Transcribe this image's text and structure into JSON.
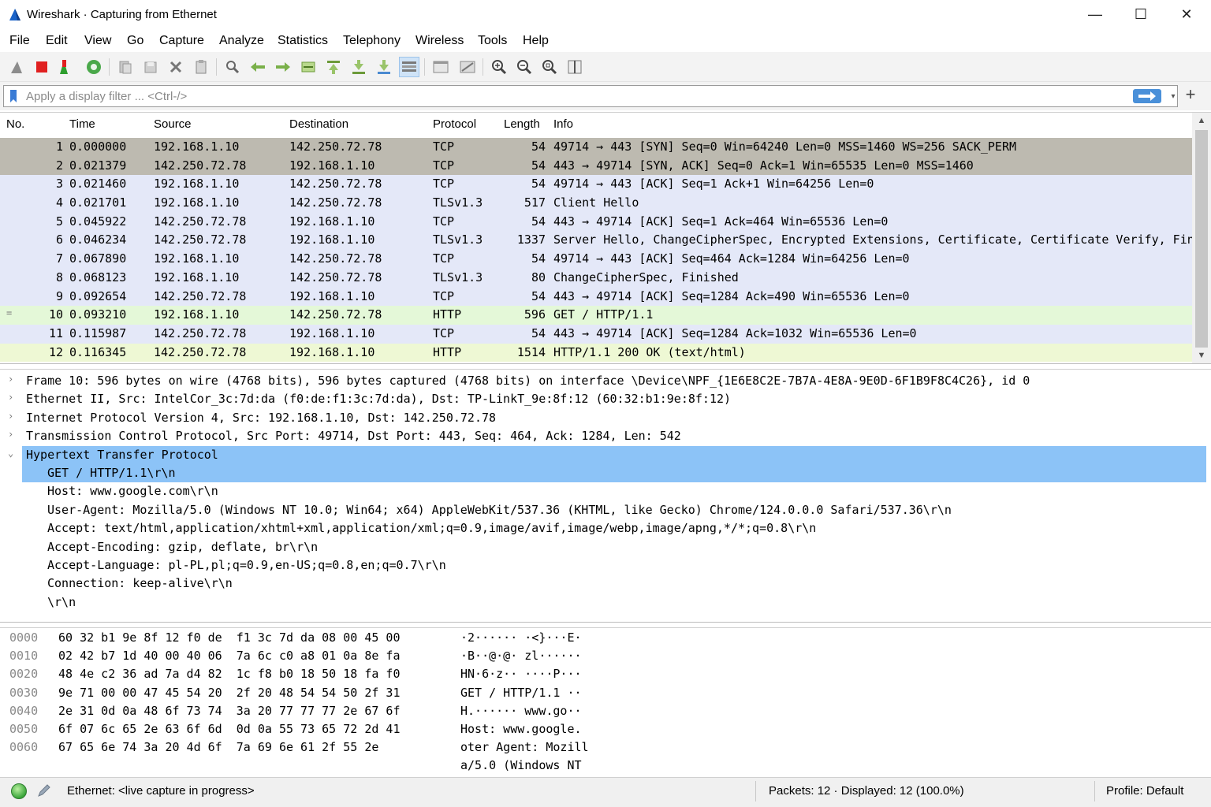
{
  "window": {
    "title": "Wireshark · Capturing from Ethernet",
    "controls": {
      "minimize": "—",
      "maximize": "☐",
      "close": "✕"
    }
  },
  "menu": [
    "File",
    "Edit",
    "View",
    "Go",
    "Capture",
    "Analyze",
    "Statistics",
    "Telephony",
    "Wireless",
    "Tools",
    "Help"
  ],
  "toolbar": {
    "icons": [
      "shark-fin-start-icon",
      "stop-square-icon",
      "restart-icon",
      "capture-options-icon",
      "open-file-icon",
      "save-file-icon",
      "close-file-icon",
      "reload-file-icon",
      "find-packet-icon",
      "go-back-icon",
      "go-forward-icon",
      "go-to-packet-icon",
      "go-first-icon",
      "go-last-icon",
      "autoscroll-icon",
      "colorize-icon",
      "auto-resize-icon",
      "zoom-in-icon",
      "zoom-out-icon",
      "normal-size-icon",
      "resize-columns-icon"
    ]
  },
  "filter": {
    "placeholder": "Apply a display filter ... <Ctrl-/>",
    "apply_icon": "arrow-right-icon",
    "dropdown": "▾",
    "add": "+"
  },
  "packet_list": {
    "columns": [
      "No.",
      "Time",
      "Source",
      "Destination",
      "Protocol",
      "Length",
      "Info"
    ],
    "rows": [
      {
        "no": "1",
        "time": "0.000000",
        "src": "192.168.1.10",
        "dst": "142.250.72.78",
        "proto": "TCP",
        "len": "54",
        "info": "49714 → 443 [SYN] Seq=0 Win=64240 Len=0 MSS=1460 WS=256 SACK_PERM",
        "bg": "#bdbab0",
        "mark": ""
      },
      {
        "no": "2",
        "time": "0.021379",
        "src": "142.250.72.78",
        "dst": "192.168.1.10",
        "proto": "TCP",
        "len": "54",
        "info": "443 → 49714 [SYN, ACK] Seq=0 Ack=1 Win=65535 Len=0 MSS=1460",
        "bg": "#bdbab0",
        "mark": ""
      },
      {
        "no": "3",
        "time": "0.021460",
        "src": "192.168.1.10",
        "dst": "142.250.72.78",
        "proto": "TCP",
        "len": "54",
        "info": "49714 → 443 [ACK] Seq=1 Ack+1 Win=64256 Len=0",
        "bg": "#e4e8f8",
        "mark": ""
      },
      {
        "no": "4",
        "time": "0.021701",
        "src": "192.168.1.10",
        "dst": "142.250.72.78",
        "proto": "TLSv1.3",
        "len": "517",
        "info": "Client Hello",
        "bg": "#e4e8f8",
        "mark": ""
      },
      {
        "no": "5",
        "time": "0.045922",
        "src": "142.250.72.78",
        "dst": "192.168.1.10",
        "proto": "TCP",
        "len": "54",
        "info": "443 → 49714 [ACK] Seq=1 Ack=464 Win=65536 Len=0",
        "bg": "#e4e8f8",
        "mark": ""
      },
      {
        "no": "6",
        "time": "0.046234",
        "src": "142.250.72.78",
        "dst": "192.168.1.10",
        "proto": "TLSv1.3",
        "len": "1337",
        "info": "Server Hello, ChangeCipherSpec, Encrypted Extensions, Certificate, Certificate Verify, Finished",
        "bg": "#e4e8f8",
        "mark": ""
      },
      {
        "no": "7",
        "time": "0.067890",
        "src": "192.168.1.10",
        "dst": "142.250.72.78",
        "proto": "TCP",
        "len": "54",
        "info": "49714 → 443 [ACK] Seq=464 Ack=1284 Win=64256 Len=0",
        "bg": "#e4e8f8",
        "mark": ""
      },
      {
        "no": "8",
        "time": "0.068123",
        "src": "192.168.1.10",
        "dst": "142.250.72.78",
        "proto": "TLSv1.3",
        "len": "80",
        "info": "ChangeCipherSpec, Finished",
        "bg": "#e4e8f8",
        "mark": ""
      },
      {
        "no": "9",
        "time": "0.092654",
        "src": "142.250.72.78",
        "dst": "192.168.1.10",
        "proto": "TCP",
        "len": "54",
        "info": "443 → 49714 [ACK] Seq=1284 Ack=490 Win=65536 Len=0",
        "bg": "#e4e8f8",
        "mark": ""
      },
      {
        "no": "10",
        "time": "0.093210",
        "src": "192.168.1.10",
        "dst": "142.250.72.78",
        "proto": "HTTP",
        "len": "596",
        "info": "GET / HTTP/1.1",
        "bg": "#e4f8d8",
        "mark": "="
      },
      {
        "no": "11",
        "time": "0.115987",
        "src": "142.250.72.78",
        "dst": "192.168.1.10",
        "proto": "TCP",
        "len": "54",
        "info": "443 → 49714 [ACK] Seq=1284 Ack=1032 Win=65536 Len=0",
        "bg": "#e4e8f8",
        "mark": ""
      },
      {
        "no": "12",
        "time": "0.116345",
        "src": "142.250.72.78",
        "dst": "192.168.1.10",
        "proto": "HTTP",
        "len": "1514",
        "info": "HTTP/1.1 200 OK  (text/html)",
        "bg": "#eef8d4",
        "mark": ""
      }
    ]
  },
  "details": [
    {
      "arrow": "›",
      "indent": 0,
      "text": "Frame 10: 596 bytes on wire (4768 bits), 596 bytes captured (4768 bits) on interface \\Device\\NPF_{1E6E8C2E-7B7A-4E8A-9E0D-6F1B9F8C4C26}, id 0",
      "selected": false
    },
    {
      "arrow": "›",
      "indent": 0,
      "text": "Ethernet II, Src: IntelCor_3c:7d:da (f0:de:f1:3c:7d:da), Dst: TP-LinkT_9e:8f:12 (60:32:b1:9e:8f:12)",
      "selected": false
    },
    {
      "arrow": "›",
      "indent": 0,
      "text": "Internet Protocol Version 4, Src: 192.168.1.10, Dst: 142.250.72.78",
      "selected": false
    },
    {
      "arrow": "›",
      "indent": 0,
      "text": "Transmission Control Protocol, Src Port: 49714, Dst Port: 443, Seq: 464, Ack: 1284, Len: 542",
      "selected": false
    },
    {
      "arrow": "⌄",
      "indent": 0,
      "text": "Hypertext Transfer Protocol",
      "selected": true
    },
    {
      "arrow": "",
      "indent": 1,
      "text": "GET / HTTP/1.1\\r\\n",
      "selected": true
    },
    {
      "arrow": "",
      "indent": 1,
      "text": "Host: www.google.com\\r\\n",
      "selected": false
    },
    {
      "arrow": "",
      "indent": 1,
      "text": "User-Agent: Mozilla/5.0 (Windows NT 10.0; Win64; x64) AppleWebKit/537.36 (KHTML, like Gecko) Chrome/124.0.0.0 Safari/537.36\\r\\n",
      "selected": false
    },
    {
      "arrow": "",
      "indent": 1,
      "text": "Accept: text/html,application/xhtml+xml,application/xml;q=0.9,image/avif,image/webp,image/apng,*/*;q=0.8\\r\\n",
      "selected": false
    },
    {
      "arrow": "",
      "indent": 1,
      "text": "Accept-Encoding: gzip, deflate, br\\r\\n",
      "selected": false
    },
    {
      "arrow": "",
      "indent": 1,
      "text": "Accept-Language: pl-PL,pl;q=0.9,en-US;q=0.8,en;q=0.7\\r\\n",
      "selected": false
    },
    {
      "arrow": "",
      "indent": 1,
      "text": "Connection: keep-alive\\r\\n",
      "selected": false
    },
    {
      "arrow": "",
      "indent": 1,
      "text": "\\r\\n",
      "selected": false
    }
  ],
  "hex": [
    {
      "off": "0000",
      "bytes": "60 32 b1 9e 8f 12 f0 de  f1 3c 7d da 08 00 45 00",
      "ascii": "·2······ ·<}···E·"
    },
    {
      "off": "0010",
      "bytes": "02 42 b7 1d 40 00 40 06  7a 6c c0 a8 01 0a 8e fa",
      "ascii": "·B··@·@· zl······"
    },
    {
      "off": "0020",
      "bytes": "48 4e c2 36 ad 7a d4 82  1c f8 b0 18 50 18 fa f0",
      "ascii": "HN·6·z·· ····P···"
    },
    {
      "off": "0030",
      "bytes": "9e 71 00 00 47 45 54 20  2f 20 48 54 54 50 2f 31",
      "ascii": "GET / HTTP/1.1 ··"
    },
    {
      "off": "0040",
      "bytes": "2e 31 0d 0a 48 6f 73 74  3a 20 77 77 77 2e 67 6f",
      "ascii": "H.······ www.go··"
    },
    {
      "off": "0050",
      "bytes": "6f 07 6c 65 2e 63 6f 6d  0d 0a 55 73 65 72 2d 41",
      "ascii": "Host: www.google."
    },
    {
      "off": "0060",
      "bytes": "67 65 6e 74 3a 20 4d 6f  7a 69 6e 61 2f 55 2e",
      "ascii": "oter Agent: Mozill"
    },
    {
      "off": "",
      "bytes": "",
      "ascii": "a/5.0 (Windows NT"
    }
  ],
  "status": {
    "left": "Ethernet: <live capture in progress>",
    "packets": "Packets: 12 · Displayed: 12 (100.0%)",
    "profile": "Profile: Default"
  },
  "colors": {
    "selection": "#8cc3f7",
    "tcp_syn": "#bdbab0",
    "tcp_tls": "#e4e8f8",
    "http": "#e4f8d8",
    "accent": "#4a90d9"
  }
}
